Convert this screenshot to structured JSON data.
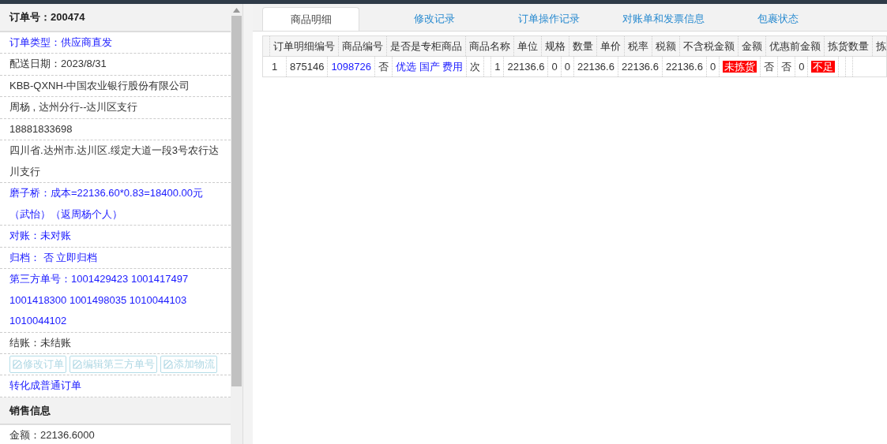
{
  "order_panel": {
    "title": "订单号：200474",
    "rows": [
      {
        "kind": "link",
        "text": "订单类型：供应商直发"
      },
      {
        "kind": "text",
        "text": "配送日期：2023/8/31"
      },
      {
        "kind": "text",
        "text": "KBB-QXNH-中国农业银行股份有限公司"
      },
      {
        "kind": "text",
        "text": "周杨 , 达州分行--达川区支行"
      },
      {
        "kind": "text",
        "text": "18881833698"
      },
      {
        "kind": "text",
        "text": "四川省.达州市.达川区.绥定大道一段3号农行达川支行"
      },
      {
        "kind": "link",
        "text": "磨子桥：成本=22136.60*0.83=18400.00元（武怡）（返周杨个人）"
      },
      {
        "kind": "link",
        "text": "对账：未对账"
      },
      {
        "kind": "link",
        "text": "归档： 否 立即归档"
      },
      {
        "kind": "link",
        "text": "第三方单号：1001429423 1001417497 1001418300 1001498035 1010044103 1010044102"
      },
      {
        "kind": "text",
        "text": "结账：未结账"
      },
      {
        "kind": "buttons",
        "buttons": [
          {
            "label": "修改订单",
            "disabled": true
          },
          {
            "label": "编辑第三方单号",
            "disabled": true
          },
          {
            "label": "添加物流",
            "disabled": true
          }
        ]
      },
      {
        "kind": "link",
        "text": "转化成普通订单"
      }
    ]
  },
  "sales_panel": {
    "title": "销售信息",
    "rows": [
      {
        "kind": "text",
        "text": "金额：22136.6000"
      }
    ]
  },
  "tabs": [
    {
      "label": "商品明细",
      "selected": true
    },
    {
      "label": "修改记录",
      "selected": false
    },
    {
      "label": "订单操作记录",
      "selected": false
    },
    {
      "label": "对账单和发票信息",
      "selected": false
    },
    {
      "label": "包裹状态",
      "selected": false
    }
  ],
  "detail_grid": {
    "header_labels": [
      "订单明细编号",
      "商品编号",
      "是否是专柜商品",
      "商品名称",
      "单位",
      "规格",
      "数量",
      "单价",
      "税率",
      "税额",
      "不含税金额",
      "金额",
      "优惠前金额",
      "拣货数量",
      "拣"
    ],
    "entries": [
      {
        "number": "1",
        "values": [
          {
            "kind": "text",
            "text": "875146"
          },
          {
            "kind": "link",
            "text": "1098726"
          },
          {
            "kind": "text",
            "text": "否"
          },
          {
            "kind": "link",
            "text": "优选 国产 费用"
          },
          {
            "kind": "text",
            "text": "次"
          },
          {
            "kind": "empty"
          },
          {
            "kind": "num",
            "text": "1"
          },
          {
            "kind": "text",
            "text": "22136.6"
          },
          {
            "kind": "text",
            "text": "0"
          },
          {
            "kind": "text",
            "text": "0"
          },
          {
            "kind": "text",
            "text": "22136.6"
          },
          {
            "kind": "text",
            "text": "22136.6"
          },
          {
            "kind": "text",
            "text": "22136.6"
          },
          {
            "kind": "text",
            "text": "0"
          },
          {
            "kind": "alert",
            "text": "未拣货"
          },
          {
            "kind": "text",
            "text": "否"
          },
          {
            "kind": "text",
            "text": "否"
          },
          {
            "kind": "text",
            "text": "0"
          },
          {
            "kind": "alert",
            "text": "不足"
          },
          {
            "kind": "empty"
          },
          {
            "kind": "empty"
          }
        ]
      }
    ]
  }
}
